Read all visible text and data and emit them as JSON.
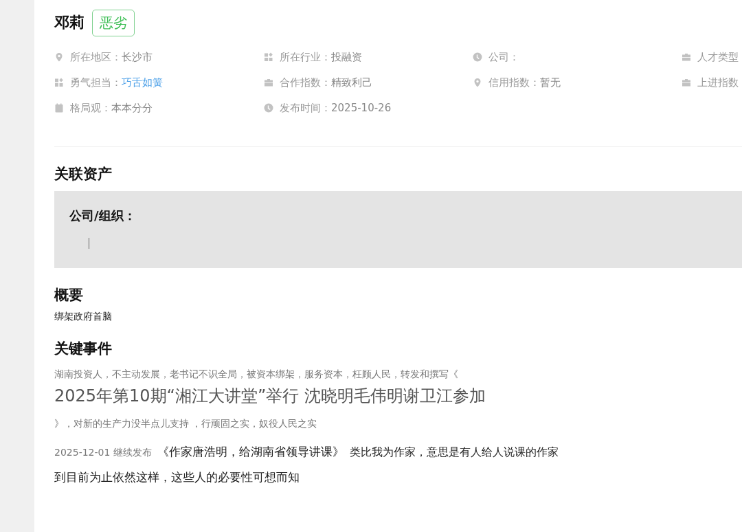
{
  "profile": {
    "name": "邓莉",
    "tag": "恶劣"
  },
  "info_rows": [
    [
      {
        "kind": "pin",
        "label": "所在地区：",
        "value": "长沙市",
        "link": false
      },
      {
        "kind": "grid",
        "label": "所在行业：",
        "value": "投融资",
        "link": false
      },
      {
        "kind": "clock",
        "label": "公司：",
        "link": false
      },
      {
        "kind": "briefcase",
        "label": "人才类型",
        "link": false
      }
    ],
    [
      {
        "kind": "grid",
        "label": "勇气担当：",
        "value": "巧舌如簧",
        "link": true
      },
      {
        "kind": "briefcase",
        "label": "合作指数：",
        "value": "精致利己",
        "link": false
      },
      {
        "kind": "pin",
        "label": "信用指数：",
        "value": "暂无",
        "link": false
      },
      {
        "kind": "briefcase",
        "label": "上进指数",
        "link": false
      }
    ],
    [
      {
        "kind": "calendar",
        "label": "格局观：",
        "value": "本本分分",
        "link": false
      },
      {
        "kind": "clock",
        "label": "发布时间：",
        "value": "2025-10-26",
        "link": false
      }
    ]
  ],
  "assets": {
    "title": "关联资产",
    "label": "公司/组织："
  },
  "summary": {
    "title": "概要",
    "text": "绑架政府首脑"
  },
  "events": {
    "title": "关键事件",
    "intro": "湖南投资人，不主动发展，老书记不识全局，被资本绑架，服务资本，枉顾人民，转发和撰写《",
    "headline": "2025年第10期“湘江大讲堂”举行 沈晓明毛伟明谢卫江参加",
    "after": "》，对新的生产力没半点儿支持 ，行顽固之实，奴役人民之实",
    "update_date": "2025-12-01 继续发布",
    "update_title": "《作家唐浩明，给湖南省领导讲课》",
    "update_text": "类比我为作家，意思是有人给人说课的作家",
    "closing": "到目前为止依然这样，这些人的必要性可想而知"
  }
}
